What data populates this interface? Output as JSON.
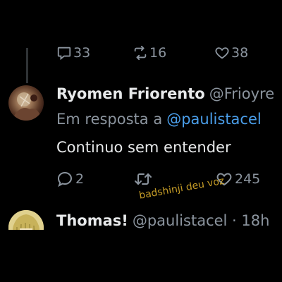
{
  "prev_tweet": {
    "actions": {
      "reply_count": "33",
      "retweet_count": "16",
      "like_count": "38"
    }
  },
  "tweet1": {
    "display_name": "Ryomen Friorento",
    "handle": "@Frioyre",
    "reply_prefix": "Em resposta a",
    "reply_mention": "@paulistacel",
    "body": "Continuo sem entender",
    "actions": {
      "reply_count": "2",
      "retweet_count": "",
      "like_count": "245"
    }
  },
  "watermark": "badshinji deu voz",
  "tweet2": {
    "display_name": "Thomas!",
    "handle": "@paulistacel · 18h"
  },
  "icons": {
    "reply": "speech-bubble-icon",
    "retweet": "retweet-arrows-icon",
    "like": "heart-outline-icon"
  },
  "colors": {
    "background": "#000000",
    "primary_text": "#e7e9ea",
    "secondary_text": "#8b949e",
    "mention": "#4a9eea",
    "watermark": "#d4a82a",
    "thread_line": "#2f3336"
  }
}
